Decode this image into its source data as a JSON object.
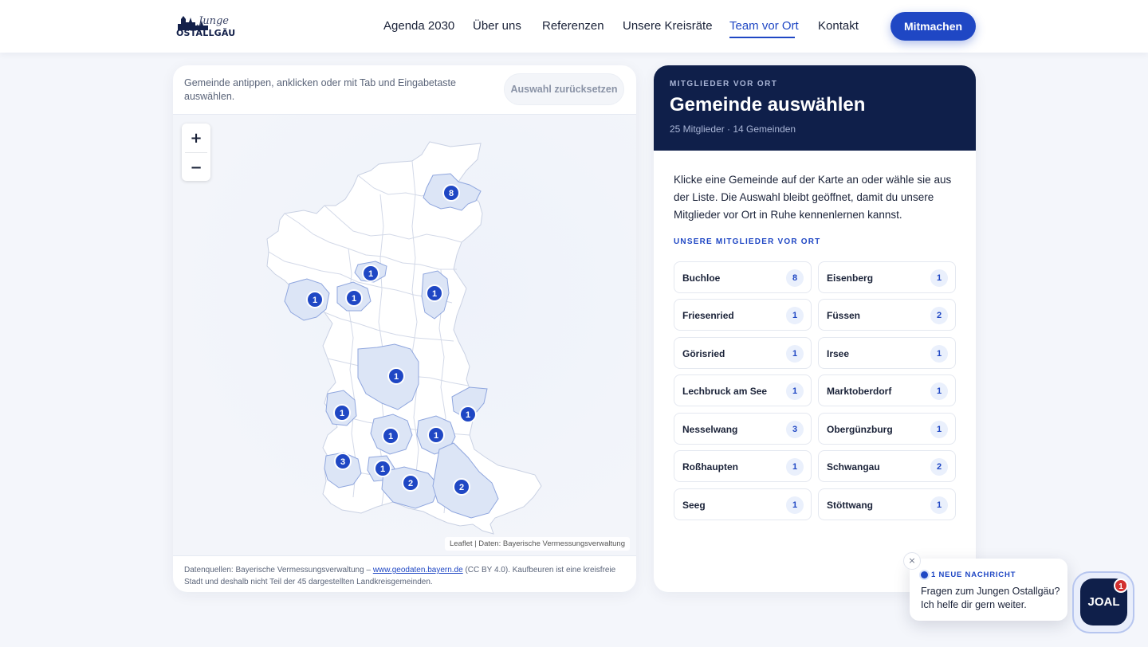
{
  "header": {
    "logo_script": "Junge",
    "logo_text": "OSTALLGÄU",
    "nav": [
      {
        "label": "Agenda 2030",
        "active": false
      },
      {
        "label": "Über uns",
        "active": false
      },
      {
        "label": "Referenzen",
        "active": false
      },
      {
        "label": "Unsere Kreisräte",
        "active": false
      },
      {
        "label": "Team vor Ort",
        "active": true
      },
      {
        "label": "Kontakt",
        "active": false
      }
    ],
    "cta_label": "Mitmachen"
  },
  "map": {
    "hint": "Gemeinde antippen, anklicken oder mit Tab und Eingabetaste auswählen.",
    "reset_label": "Auswahl zurücksetzen",
    "zoom_in": "+",
    "zoom_out": "−",
    "attribution": "Leaflet | Daten: Bayerische Vermessungsverwaltung",
    "markers": [
      {
        "label": "8"
      },
      {
        "label": "1"
      },
      {
        "label": "1"
      },
      {
        "label": "1"
      },
      {
        "label": "1"
      },
      {
        "label": "1"
      },
      {
        "label": "1"
      },
      {
        "label": "1"
      },
      {
        "label": "1"
      },
      {
        "label": "1"
      },
      {
        "label": "3"
      },
      {
        "label": "1"
      },
      {
        "label": "2"
      },
      {
        "label": "2"
      }
    ],
    "footer_prefix": "Datenquellen: Bayerische Vermessungsverwaltung – ",
    "footer_link": "www.geodaten.bayern.de",
    "footer_suffix": " (CC BY 4.0). Kaufbeuren ist eine kreisfreie Stadt und deshalb nicht Teil der 45 dargestellten Landkreisgemeinden."
  },
  "panel": {
    "eyebrow": "MITGLIEDER VOR ORT",
    "title": "Gemeinde auswählen",
    "subtitle": "25 Mitglieder · 14 Gemeinden",
    "text": "Klicke eine Gemeinde auf der Karte an oder wähle sie aus der Liste. Die Auswahl bleibt geöffnet, damit du unsere Mitglieder vor Ort in Ruhe kennenlernen kannst.",
    "list_eyebrow": "UNSERE MITGLIEDER VOR ORT",
    "items": [
      {
        "name": "Buchloe",
        "count": "8"
      },
      {
        "name": "Eisenberg",
        "count": "1"
      },
      {
        "name": "Friesenried",
        "count": "1"
      },
      {
        "name": "Füssen",
        "count": "2"
      },
      {
        "name": "Görisried",
        "count": "1"
      },
      {
        "name": "Irsee",
        "count": "1"
      },
      {
        "name": "Lechbruck am See",
        "count": "1"
      },
      {
        "name": "Marktoberdorf",
        "count": "1"
      },
      {
        "name": "Nesselwang",
        "count": "3"
      },
      {
        "name": "Obergünzburg",
        "count": "1"
      },
      {
        "name": "Roßhaupten",
        "count": "1"
      },
      {
        "name": "Schwangau",
        "count": "2"
      },
      {
        "name": "Seeg",
        "count": "1"
      },
      {
        "name": "Stöttwang",
        "count": "1"
      }
    ]
  },
  "chat": {
    "close": "×",
    "eyebrow": "1 NEUE NACHRICHT",
    "text": "Fragen zum Jungen Ostallgäu? Ich helfe dir gern weiter.",
    "button_label": "JOAL",
    "badge": "1"
  },
  "colors": {
    "accent": "#1f47c4",
    "navy": "#0f1f4a",
    "badge_red": "#d22f2f"
  }
}
